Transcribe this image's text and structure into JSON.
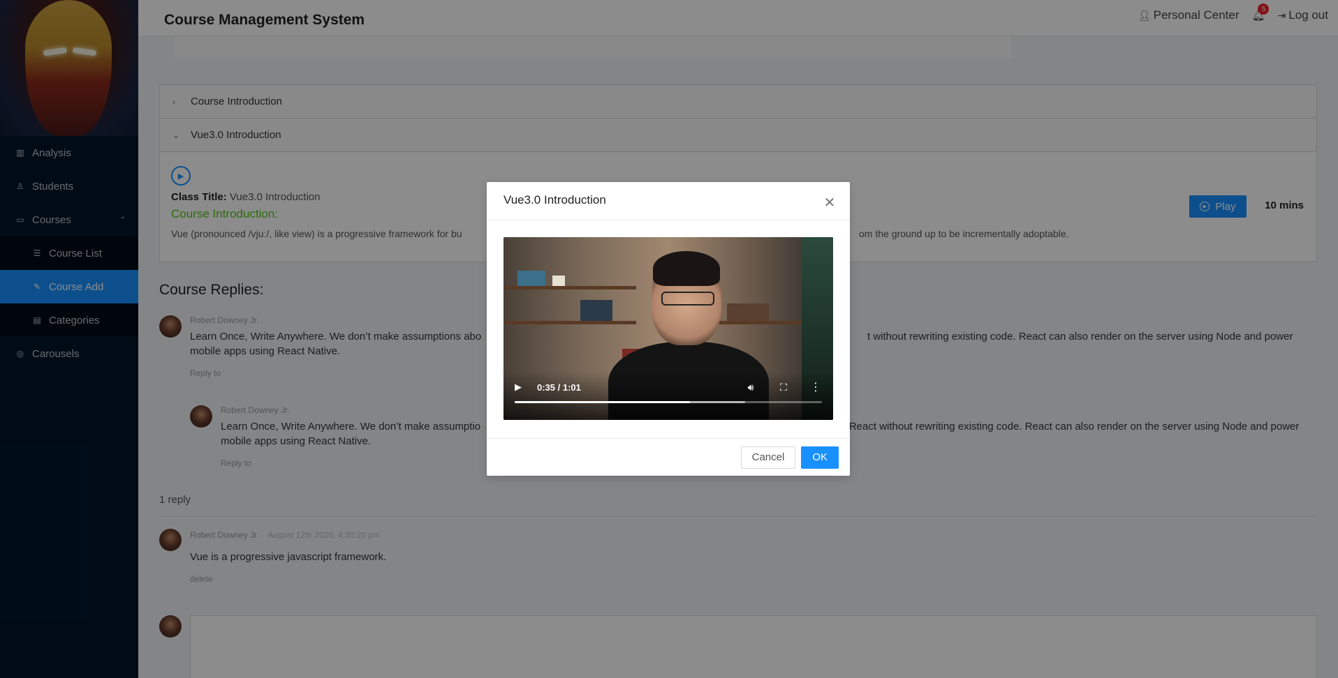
{
  "header": {
    "title": "Course Management System",
    "personal_center": "Personal Center",
    "notifications_count": "5",
    "logout": "Log out"
  },
  "sidebar": {
    "items": [
      {
        "label": "Analysis",
        "icon": "chart-icon"
      },
      {
        "label": "Students",
        "icon": "user-icon"
      },
      {
        "label": "Courses",
        "icon": "desktop-icon"
      },
      {
        "label": "Course List",
        "icon": "list-icon"
      },
      {
        "label": "Course Add",
        "icon": "edit-icon"
      },
      {
        "label": "Categories",
        "icon": "file-icon"
      },
      {
        "label": "Carousels",
        "icon": "carousel-icon"
      }
    ],
    "active": "Course Add"
  },
  "course": {
    "panel1_title": "Course Introduction",
    "panel2_title": "Vue3.0 Introduction",
    "class_title_label": "Class Title:",
    "class_title_value": "Vue3.0 Introduction",
    "intro_heading": "Course Introduction:",
    "intro_text": "Vue (pronounced /vjuː/, like view) is a progressive framework for bu",
    "intro_text_tail": "om the ground up to be incrementally adoptable.",
    "play_label": "Play",
    "duration": "10 mins"
  },
  "replies": {
    "title": "Course Replies:",
    "comment1": {
      "author": "Robert Downey Jr.",
      "text_line1": "Learn Once, Write Anywhere. We don’t make assumptions abo",
      "text_line1_tail": "t without rewriting existing code. React can also render on the server using Node and power",
      "text_line2": "mobile apps using React Native.",
      "action": "Reply to"
    },
    "comment2": {
      "author": "Robert Downey Jr.",
      "text_line1": "Learn Once, Write Anywhere. We don’t make assumptio",
      "text_line1_tail": "in React without rewriting existing code. React can also render on the server using Node and power",
      "text_line2": "mobile apps using React Native.",
      "action": "Reply to"
    },
    "one_reply": "1 reply",
    "comment3": {
      "author": "Robert Downey Jr.",
      "date": "August 12th 2020, 4:30:20 pm",
      "text": "Vue is a progressive javascript framework.",
      "action": "delete"
    }
  },
  "modal": {
    "title": "Vue3.0 Introduction",
    "video": {
      "time": "0:35 / 1:01",
      "played_fraction": 0.57,
      "buffered_fraction": 0.75
    },
    "cancel_label": "Cancel",
    "ok_label": "OK"
  },
  "colors": {
    "sidebar_bg": "#001529",
    "accent": "#1890ff",
    "intro_green": "#52c41a",
    "badge_red": "#f5222d"
  }
}
